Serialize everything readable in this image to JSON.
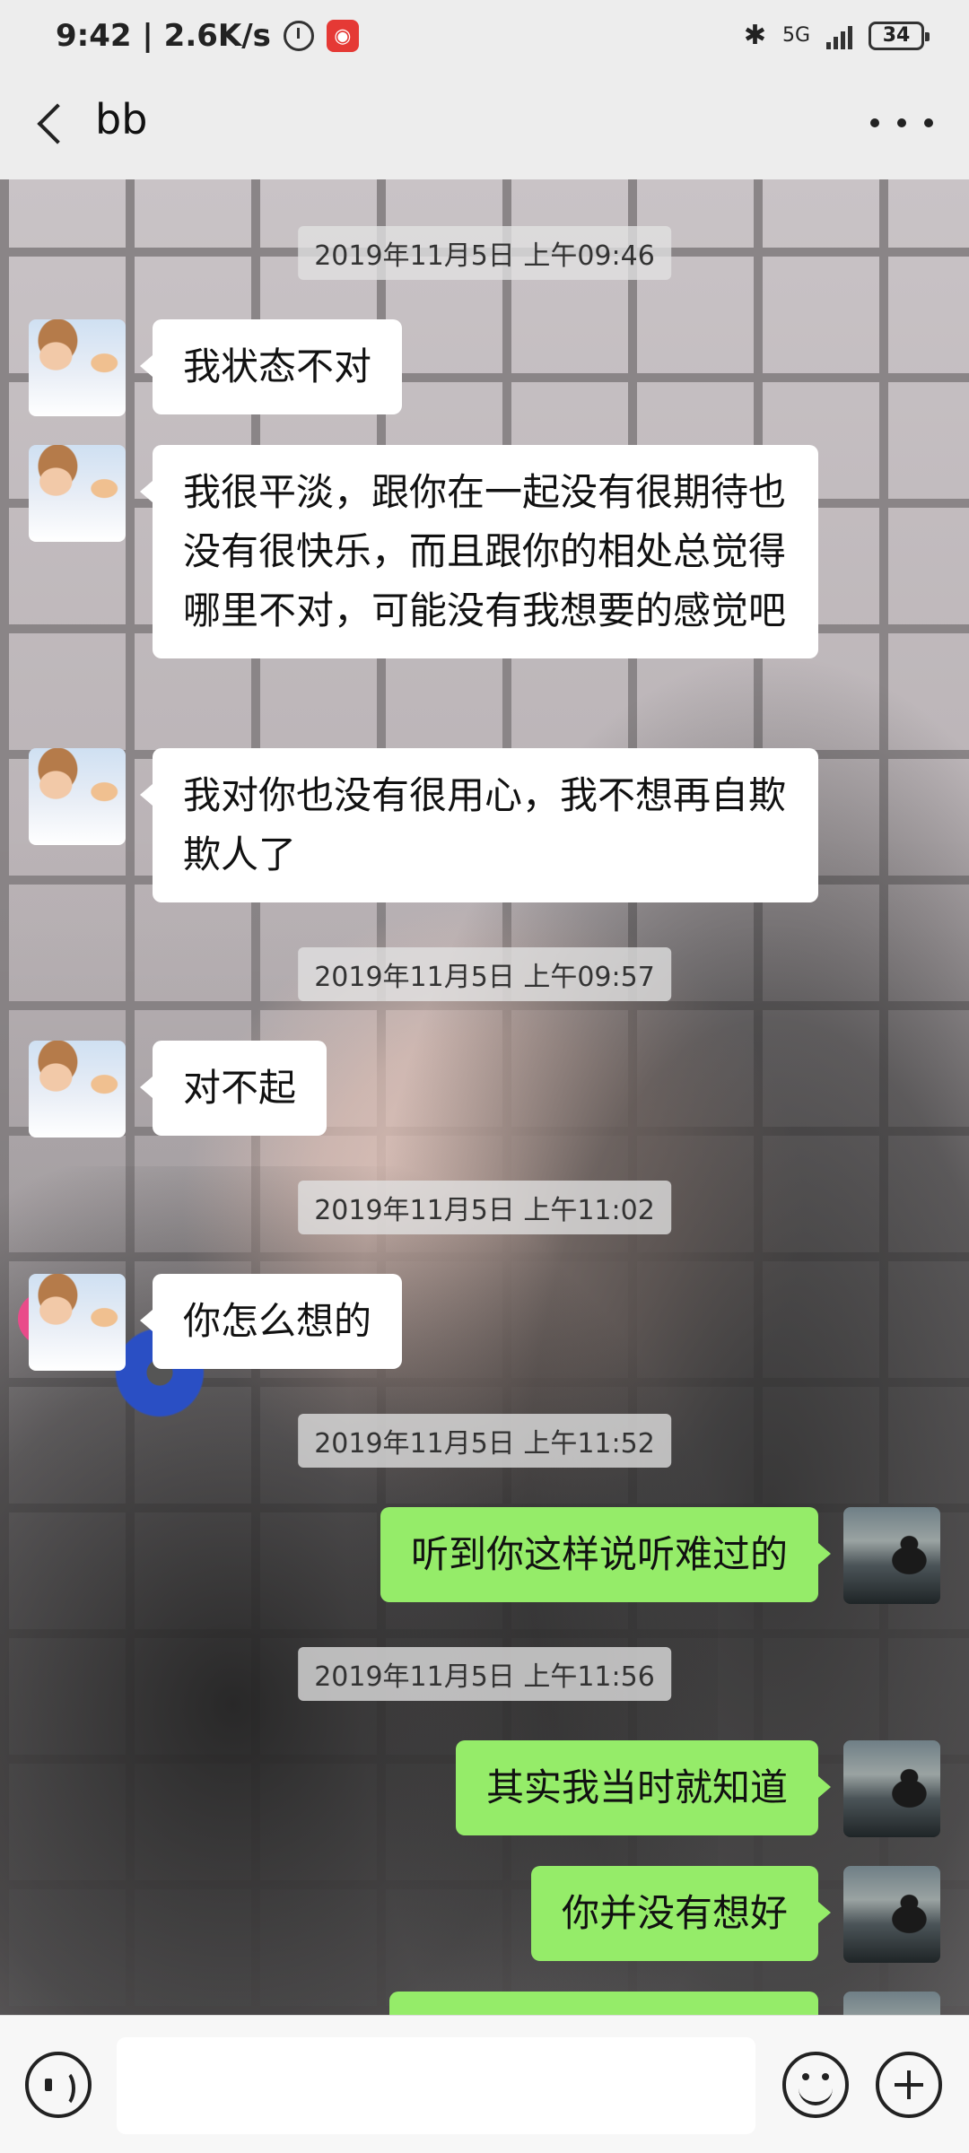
{
  "status_bar": {
    "time_speed": "9:42 | 2.6K/s",
    "app_badge": "◉",
    "network": "5G",
    "battery": "34"
  },
  "header": {
    "title": "bb"
  },
  "timestamps": [
    "2019年11月5日 上午09:46",
    "2019年11月5日 上午09:57",
    "2019年11月5日 上午11:02",
    "2019年11月5日 上午11:52",
    "2019年11月5日 上午11:56"
  ],
  "messages": [
    {
      "side": "left",
      "text": "我状态不对"
    },
    {
      "side": "left",
      "text": "我很平淡，跟你在一起没有很期待也没有很快乐，而且跟你的相处总觉得哪里不对，可能没有我想要的感觉吧"
    },
    {
      "side": "left",
      "text": "我对你也没有很用心，我不想再自欺欺人了"
    },
    {
      "side": "left",
      "text": "对不起"
    },
    {
      "side": "left",
      "text": "你怎么想的"
    },
    {
      "side": "right",
      "text": "听到你这样说听难过的"
    },
    {
      "side": "right",
      "text": "其实我当时就知道"
    },
    {
      "side": "right",
      "text": "你并没有想好"
    },
    {
      "side": "right",
      "text": ""
    }
  ],
  "input": {
    "value": "",
    "placeholder": ""
  },
  "colors": {
    "accent_green": "#95ec69",
    "bubble_white": "#ffffff",
    "app_bg": "#ededed"
  },
  "icons": [
    "back-icon",
    "more-icon",
    "voice-icon",
    "emoji-icon",
    "plus-icon",
    "alarm-icon",
    "bluetooth-icon",
    "signal-icon",
    "battery-icon"
  ]
}
